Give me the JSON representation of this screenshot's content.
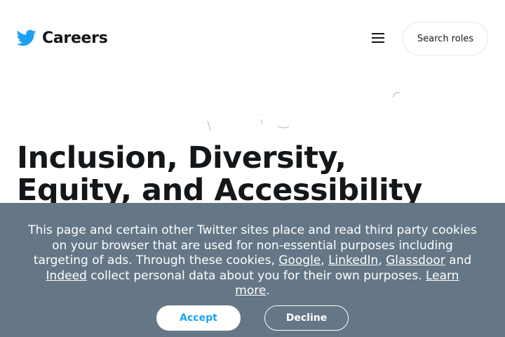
{
  "header": {
    "brand_name": "Careers",
    "logo_icon": "twitter-bird-icon",
    "menu_icon": "hamburger-menu-icon",
    "search_label": "Search roles"
  },
  "hero": {
    "title_line1": "Inclusion, Diversity,",
    "title_line2": "Equity, and Accessibility"
  },
  "cookie_banner": {
    "text_before_links": "This page and certain other Twitter sites place and read third party cookies on your browser that are used for non-essential purposes including targeting of ads. Through these cookies,",
    "link_google": "Google",
    "sep_comma_1": ",",
    "link_linkedin": "LinkedIn",
    "sep_comma_2": ",",
    "link_glassdoor": "Glassdoor",
    "sep_and": "and",
    "link_indeed": "Indeed",
    "text_after_links": "collect personal data about you for their own purposes.",
    "link_learn_more": "Learn more",
    "end_period": ".",
    "accept_label": "Accept",
    "decline_label": "Decline"
  },
  "colors": {
    "brand_blue": "#1da1f2",
    "banner_gray": "#657786",
    "text_dark": "#14171a"
  }
}
